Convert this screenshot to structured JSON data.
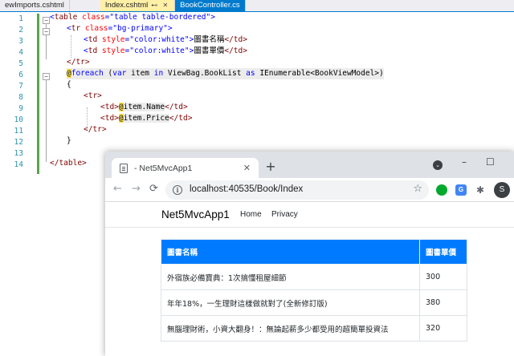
{
  "editor": {
    "tabs": [
      {
        "label": "ewImports.cshtml"
      },
      {
        "label": "Index.cshtml",
        "icons": "⊷ ✕"
      },
      {
        "label": "BookController.cs"
      }
    ],
    "line_numbers": [
      "1",
      "2",
      "3",
      "4",
      "5",
      "6",
      "7",
      "8",
      "9",
      "10",
      "11",
      "12",
      "13",
      "14"
    ],
    "code": {
      "l1_open": "<",
      "l1_tag": "table",
      "l1_attr": " class",
      "l1_eq": "=",
      "l1_str": "\"table table-bordered\"",
      "l1_close": ">",
      "l2_open": "<",
      "l2_tag": "tr",
      "l2_attr": " class",
      "l2_eq": "=",
      "l2_str": "\"bg-primary\"",
      "l2_close": ">",
      "l3_open": "<",
      "l3_tag": "td",
      "l3_attr": " style",
      "l3_eq": "=",
      "l3_str": "\"color:white\"",
      "l3_close": ">",
      "l3_text": "圖書名稱",
      "l3_end": "</td>",
      "l4_open": "<",
      "l4_tag": "td",
      "l4_attr": " style",
      "l4_eq": "=",
      "l4_str": "\"color:white\"",
      "l4_close": ">",
      "l4_text": "圖書單價",
      "l4_end": "</td>",
      "l5": "</tr>",
      "l6_at": "@",
      "l6_kw": "foreach",
      "l6_rest": " (",
      "l6_var": "var",
      "l6_mid": " item ",
      "l6_in": "in",
      "l6_expr": " ViewBag.BookList ",
      "l6_as": "as",
      "l6_type": " IEnumerable<BookViewModel>)",
      "l7": "{",
      "l8": "<tr>",
      "l9_pre": "<td>",
      "l9_at": "@",
      "l9_expr": "item.Name",
      "l9_end": "</td>",
      "l10_pre": "<td>",
      "l10_at": "@",
      "l10_expr": "item.Price",
      "l10_end": "</td>",
      "l11": "</tr>",
      "l12": "}",
      "l14": "</table>"
    }
  },
  "browser": {
    "tab_title": "- Net5MvcApp1",
    "tab_close": "✕",
    "new_tab": "+",
    "tab_search": "⌄",
    "minimize": "–",
    "maximize": "☐",
    "back": "←",
    "forward": "→",
    "reload": "⟳",
    "info": "i",
    "url": "localhost:40535/Book/Index",
    "star": "☆",
    "translate": "G",
    "puzzle": "✱",
    "profile_initial": "S",
    "site": {
      "brand": "Net5MvcApp1",
      "nav_home": "Home",
      "nav_privacy": "Privacy"
    },
    "table": {
      "headers": [
        "圖書名稱",
        "圖書單價"
      ],
      "rows": [
        {
          "name": "外宿族必備寶典：1次搞懂租屋細節",
          "price": "300"
        },
        {
          "name": "年年18%，一生理財這樣做就對了(全新修訂版)",
          "price": "380"
        },
        {
          "name": "無腦理財術，小資大翻身！：無論起薪多少都受用的超簡單投資法",
          "price": "320"
        }
      ]
    }
  }
}
